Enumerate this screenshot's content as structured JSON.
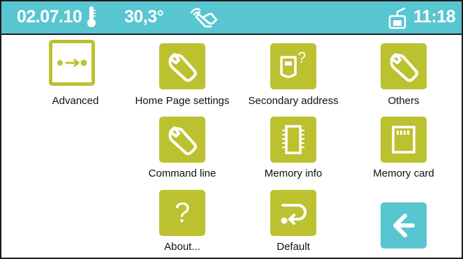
{
  "status_bar": {
    "date": "02.07.10",
    "temperature": "30,3°",
    "time": "11:18",
    "icons": [
      "thermometer-icon",
      "hand-touch-icon",
      "answering-machine-icon"
    ],
    "background": "#58c6d0"
  },
  "menu": {
    "items": [
      {
        "label": "Advanced",
        "icon": "dots-arrow-icon",
        "selected": true
      },
      {
        "label": "Home Page settings",
        "icon": "wrench-icon"
      },
      {
        "label": "Secondary address",
        "icon": "secondary-address-icon"
      },
      {
        "label": "Others",
        "icon": "wrench-icon"
      },
      {
        "label": "Command line",
        "icon": "wrench-icon"
      },
      {
        "label": "Memory info",
        "icon": "memory-chip-icon"
      },
      {
        "label": "Memory card",
        "icon": "memory-card-icon"
      },
      {
        "label": "About...",
        "icon": "question-mark-icon"
      },
      {
        "label": "Default",
        "icon": "return-arrow-icon"
      },
      {
        "label": "",
        "icon": "back-arrow-icon"
      }
    ],
    "about_glyph": "?",
    "tile_color": "#bcc12f",
    "back_color": "#58c6d0"
  }
}
